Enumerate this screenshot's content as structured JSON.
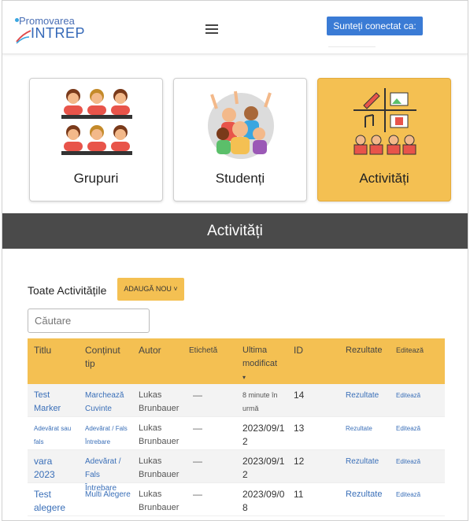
{
  "header": {
    "logo_top": "Promovarea",
    "logo_bottom": "INTREP",
    "connected_label": "Sunteți conectat ca:"
  },
  "tiles": [
    {
      "label": "Grupuri"
    },
    {
      "label": "Studenți"
    },
    {
      "label": "Activități"
    }
  ],
  "banner": {
    "title": "Activități"
  },
  "list": {
    "title": "Toate Activitățile",
    "add_button": "ADAUGĂ NOU ˅",
    "search_placeholder": "Căutare"
  },
  "table": {
    "columns": [
      "Titlu",
      "Conținut tip",
      "Autor",
      "Etichetă",
      "Ultima modificat",
      "ID",
      "Rezultate",
      "Editează"
    ],
    "sort_marker": "▾",
    "rows": [
      {
        "title": "Test Marker",
        "type": "Marchează Cuvinte",
        "author": "Lukas Brunbauer",
        "tag": "—",
        "modified": "8 minute în urmă",
        "id": "14",
        "results": "Rezultate",
        "edit": "Editează"
      },
      {
        "title": "Adevărat sau fals",
        "type": "Adevărat / Fals Întrebare",
        "author": "Lukas Brunbauer",
        "tag": "—",
        "modified": "2023/09/12",
        "id": "13",
        "results": "Rezultate",
        "edit": "Editează"
      },
      {
        "title": "vara 2023",
        "type": "Adevărat / Fals Întrebare",
        "author": "Lukas Brunbauer",
        "tag": "—",
        "modified": "2023/09/12",
        "id": "12",
        "results": "Rezultate",
        "edit": "Editează"
      },
      {
        "title": "Test alegere",
        "type": "Multi Alegere",
        "author": "Lukas Brunbauer",
        "tag": "—",
        "modified": "2023/09/08",
        "id": "11",
        "results": "Rezultate",
        "edit": "Editează"
      }
    ]
  },
  "colors": {
    "accent": "#f4c052",
    "banner": "#4a4a4a",
    "link": "#3a6fb8",
    "button_blue": "#3a7bd5"
  }
}
